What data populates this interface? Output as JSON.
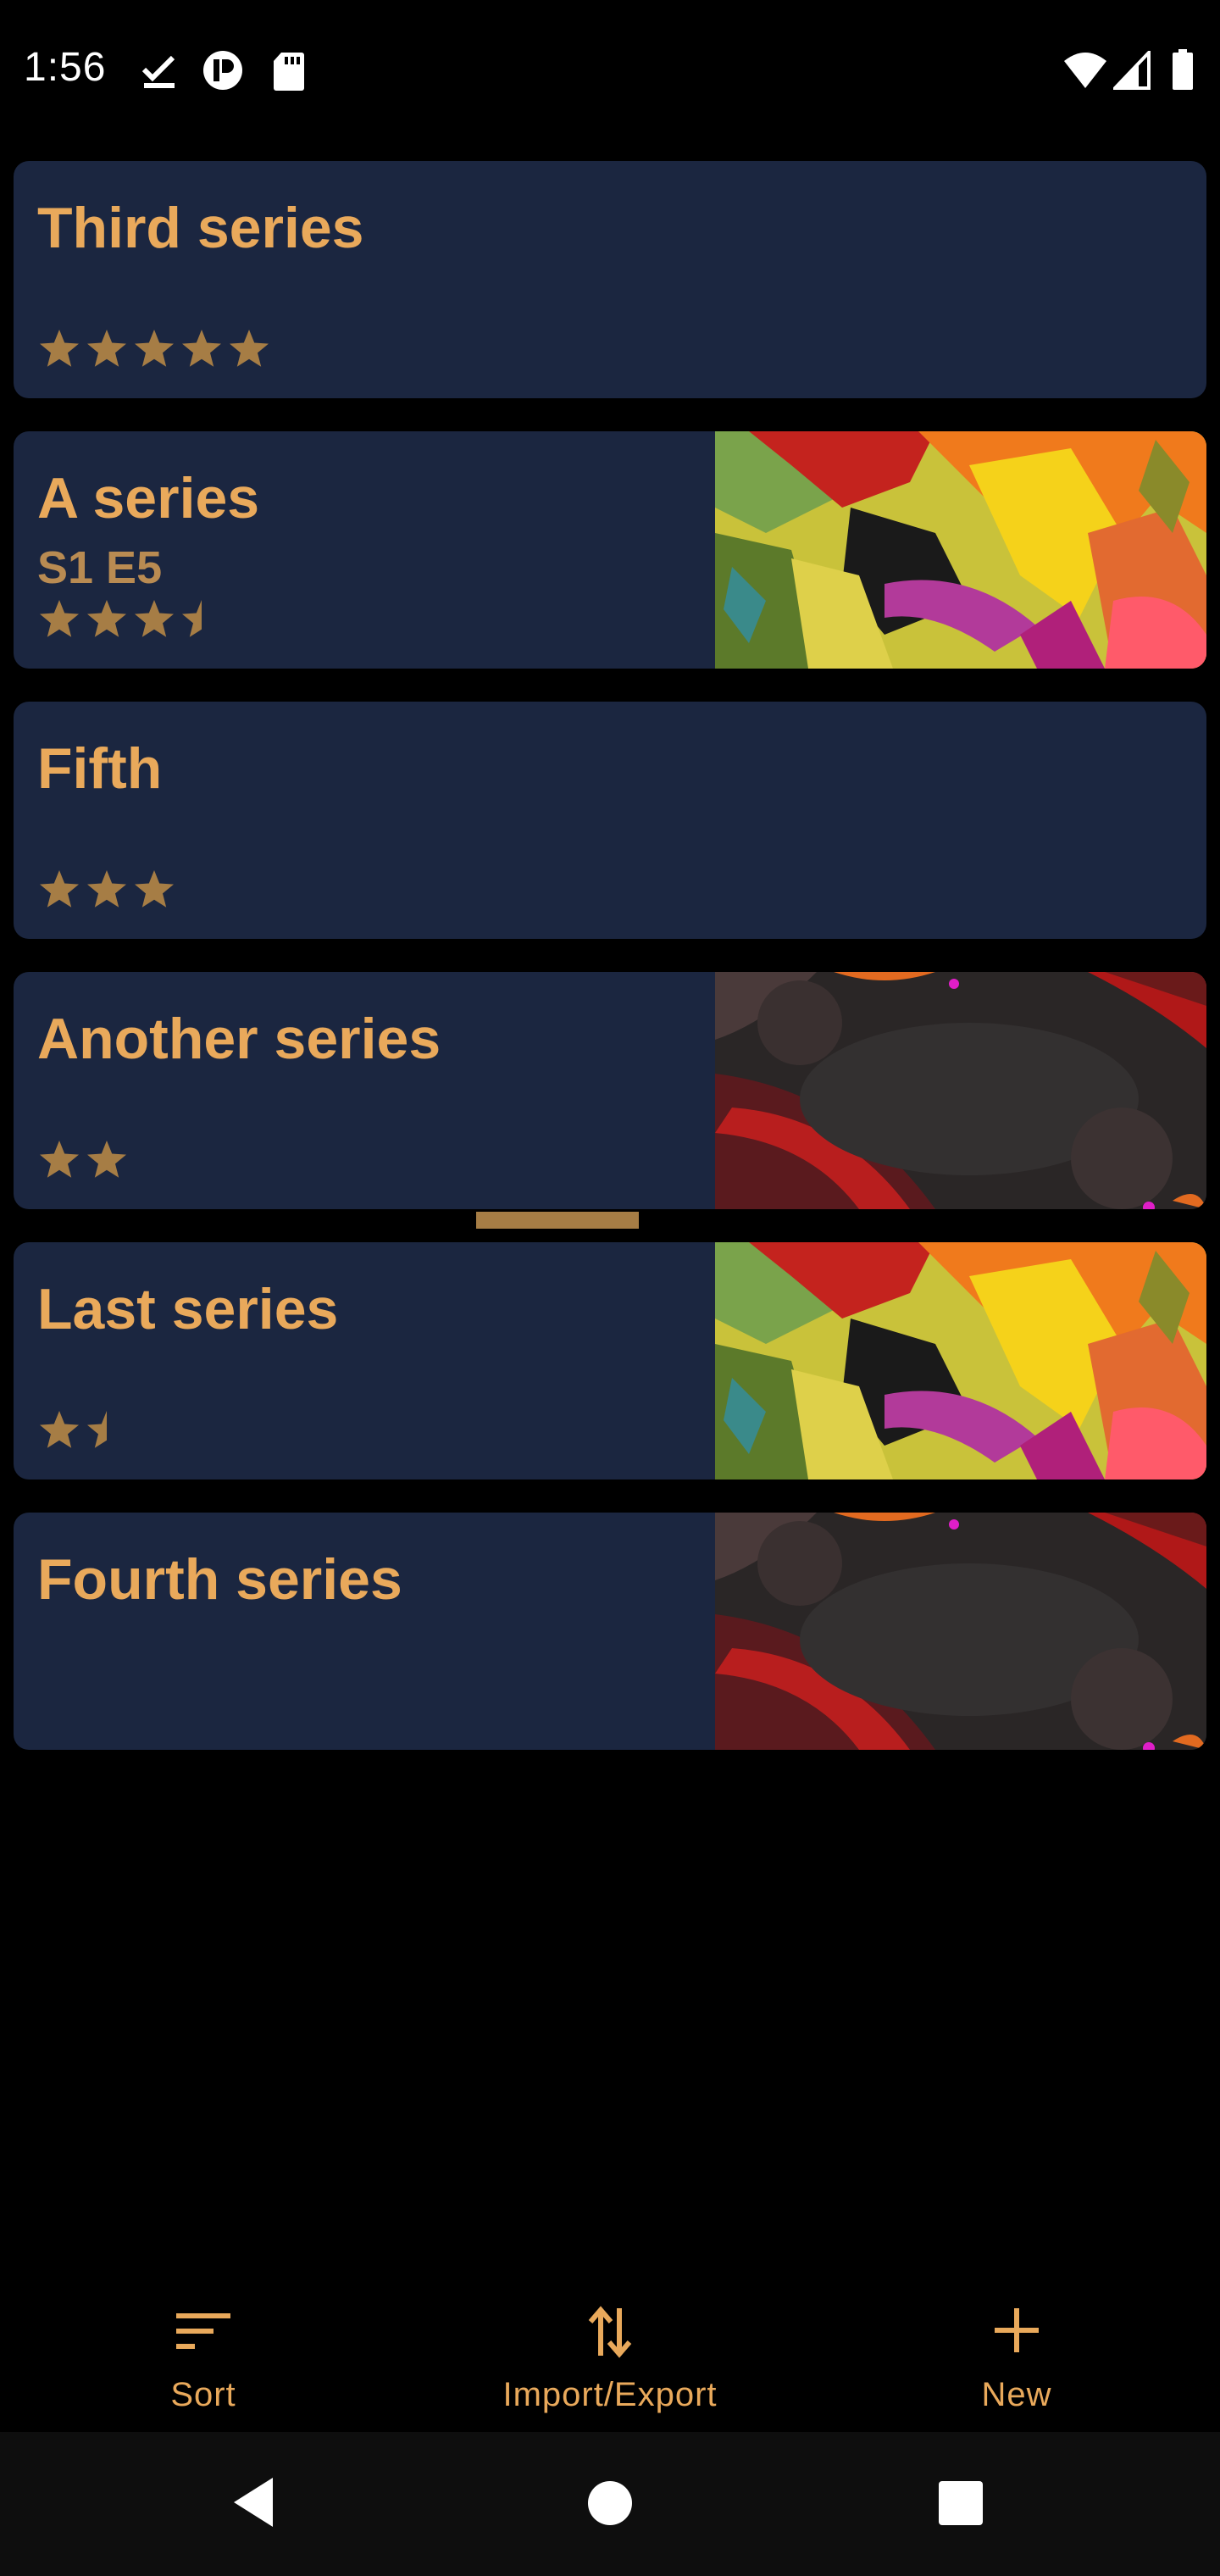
{
  "status_bar": {
    "time": "1:56",
    "left_icons": [
      "download-done-icon",
      "app-p-icon",
      "sd-card-icon"
    ],
    "right_icons": [
      "wifi-icon",
      "signal-icon",
      "battery-icon"
    ]
  },
  "series": [
    {
      "title": "Third series",
      "subtitle": "",
      "rating": 5,
      "thumbnail": "none"
    },
    {
      "title": "A series",
      "subtitle": "S1 E5",
      "rating": 3.5,
      "thumbnail": "colorful-abstract"
    },
    {
      "title": "Fifth",
      "subtitle": "",
      "rating": 3,
      "thumbnail": "none"
    },
    {
      "title": "Another series",
      "subtitle": "",
      "rating": 2,
      "thumbnail": "dark-texture"
    },
    {
      "title": "Last series",
      "subtitle": "",
      "rating": 1.5,
      "thumbnail": "colorful-abstract"
    },
    {
      "title": "Fourth series",
      "subtitle": "",
      "rating": 0,
      "thumbnail": "dark-texture"
    }
  ],
  "bottom_nav": {
    "sort_label": "Sort",
    "import_export_label": "Import/Export",
    "new_label": "New"
  },
  "system_nav": [
    "back-icon",
    "home-icon",
    "recents-icon"
  ],
  "colors": {
    "accent": "#e9a95b",
    "star": "#a67d45",
    "card_bg": "#1b2640",
    "background": "#000000"
  }
}
